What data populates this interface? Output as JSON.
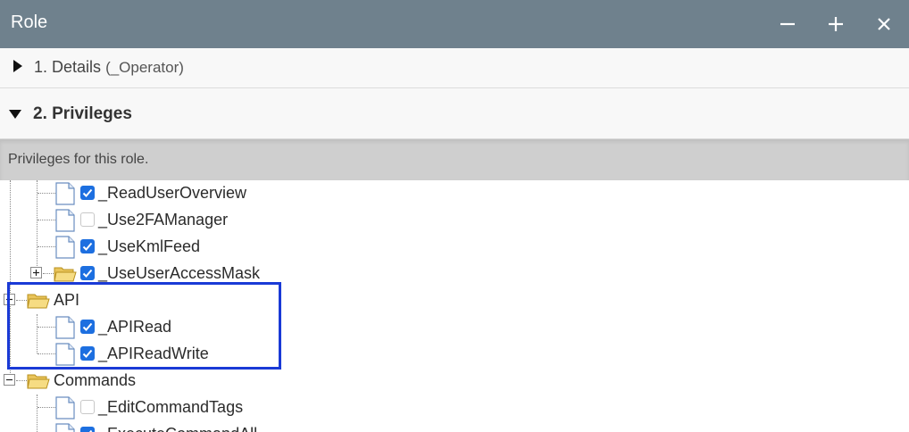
{
  "window": {
    "title": "Role",
    "minimize_icon": "minus-icon",
    "maximize_icon": "plus-icon",
    "close_icon": "close-icon"
  },
  "sections": {
    "details": {
      "label": "1. Details",
      "suffix": "(_Operator)",
      "state": "collapsed"
    },
    "privileges": {
      "label": "2. Privileges",
      "state": "expanded"
    }
  },
  "info_text": "Privileges for this role.",
  "tree": {
    "items": [
      {
        "label": "_ReadUserOverview",
        "checked": true
      },
      {
        "label": "_Use2FAManager",
        "checked": false
      },
      {
        "label": "_UseKmlFeed",
        "checked": true
      },
      {
        "label": "_UseUserAccessMask",
        "checked": true
      },
      {
        "label": "API"
      },
      {
        "label": "_APIRead",
        "checked": true
      },
      {
        "label": "_APIReadWrite",
        "checked": true
      },
      {
        "label": "Commands"
      },
      {
        "label": "_EditCommandTags",
        "checked": false
      },
      {
        "label": "_ExecuteCommandAll",
        "checked": true
      }
    ]
  },
  "colors": {
    "titlebar": "#6f818d",
    "checkbox": "#1d6fe0",
    "highlight": "#1a3ad6",
    "info_bar": "#cfcfcf"
  }
}
